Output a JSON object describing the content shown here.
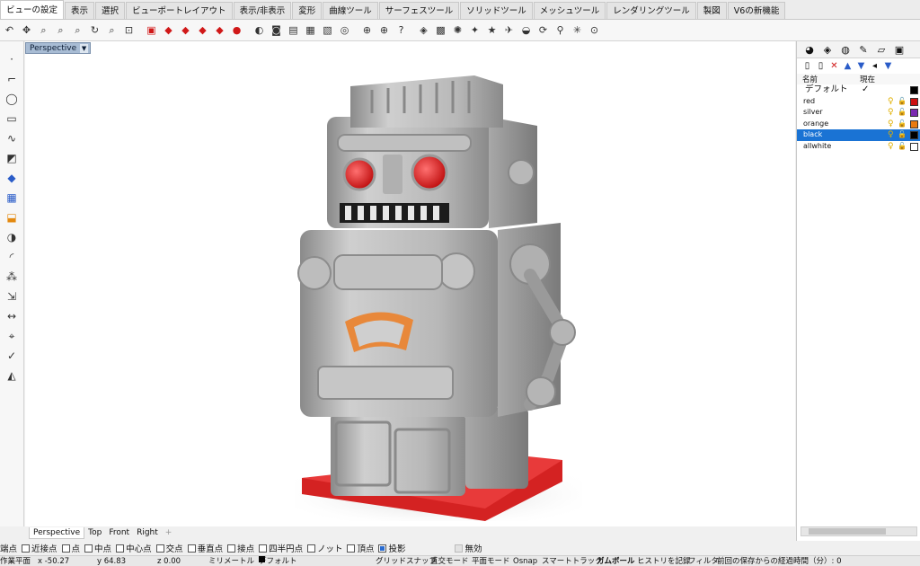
{
  "ribbon": {
    "tabs": [
      "ビューの設定",
      "表示",
      "選択",
      "ビューポートレイアウト",
      "表示/非表示",
      "変形",
      "曲線ツール",
      "サーフェスツール",
      "ソリッドツール",
      "メッシュツール",
      "レンダリングツール",
      "製図",
      "V6の新機能"
    ],
    "active_tab": "ビューの設定"
  },
  "toolbar_icons": [
    "undo-view-icon",
    "pan-icon",
    "zoom-window-icon",
    "zoom-extents-icon",
    "zoom-selected-icon",
    "rotate-view-icon",
    "zoom-icon",
    "zoom-1-to-1-icon",
    "viewport-red-icon",
    "car-red-icon",
    "car-red-icon",
    "car-red-icon",
    "car-red-icon",
    "render-red-icon",
    "display-mode-icon",
    "camera-icon",
    "print-icon",
    "grid-icon",
    "capture-icon",
    "render-preview-icon",
    "target-icon",
    "target-plus-icon",
    "help-icon",
    "layer-icon",
    "shaded-box-icon",
    "sun-icon",
    "light-icon",
    "star-icon",
    "aircraft-icon",
    "saucer-icon",
    "sync-icon",
    "walk-icon",
    "sparkle-icon",
    "reset-icon"
  ],
  "left_tools": [
    "point-icon",
    "polyline-icon",
    "circle-icon",
    "rectangle-icon",
    "curve-icon",
    "surface-icon",
    "solid-icon",
    "mesh-icon",
    "extrude-icon",
    "boolean-icon",
    "fillet-icon",
    "array-icon",
    "transform-icon",
    "dimension-icon",
    "analyze-icon",
    "check-icon",
    "render-icon"
  ],
  "viewport": {
    "label": "Perspective"
  },
  "layers_panel": {
    "tab_icons": [
      "color-wheel-icon",
      "materials-icon",
      "environment-icon",
      "pen-icon",
      "folder-icon",
      "display-icon"
    ],
    "tool_icons": [
      "new-layer-icon",
      "new-sublayer-icon",
      "delete-icon",
      "move-up-icon",
      "move-down-icon",
      "collapse-icon",
      "filter-icon"
    ],
    "header_name": "名前",
    "header_current": "現在",
    "layers": [
      {
        "name": "デフォルト",
        "current": "✓",
        "color": "#000000"
      },
      {
        "name": "red",
        "color": "#cc1111"
      },
      {
        "name": "silver",
        "color": "#7a2ab0"
      },
      {
        "name": "orange",
        "color": "#e87a10"
      },
      {
        "name": "black",
        "color": "#000000"
      },
      {
        "name": "allwhite",
        "color": "#ffffff"
      }
    ],
    "selected_layer": "black"
  },
  "view_tabs": [
    "Perspective",
    "Top",
    "Front",
    "Right"
  ],
  "active_view_tab": "Perspective",
  "osnap": [
    {
      "label": "端点",
      "checked": false
    },
    {
      "label": "近接点",
      "checked": false
    },
    {
      "label": "点",
      "checked": false
    },
    {
      "label": "中点",
      "checked": false
    },
    {
      "label": "中心点",
      "checked": false
    },
    {
      "label": "交点",
      "checked": false
    },
    {
      "label": "垂直点",
      "checked": false
    },
    {
      "label": "接点",
      "checked": false
    },
    {
      "label": "四半円点",
      "checked": false
    },
    {
      "label": "ノット",
      "checked": false
    },
    {
      "label": "頂点",
      "checked": false
    },
    {
      "label": "投影",
      "checked": true
    },
    {
      "label": "無効",
      "checked": false
    }
  ],
  "status": {
    "cplane": "作業平面",
    "x": "x -50.27",
    "y": "y 64.83",
    "z": "z 0.00",
    "units": "ミリメートル",
    "layer": "デフォルト",
    "grid_snap": "グリッドスナップ",
    "ortho": "直交モード",
    "planar": "平面モード",
    "osnap": "Osnap",
    "smarttrack": "スマートトラック",
    "gumball": "ガムボール",
    "history": "ヒストリを記録",
    "filter": "フィルタ",
    "autosave": "前回の保存からの経過時間（分）: 0"
  },
  "colors": {
    "accent": "#1a73d4",
    "robot_eye": "#e01818",
    "robot_base": "#d42222",
    "robot_panel": "#e8883a"
  }
}
